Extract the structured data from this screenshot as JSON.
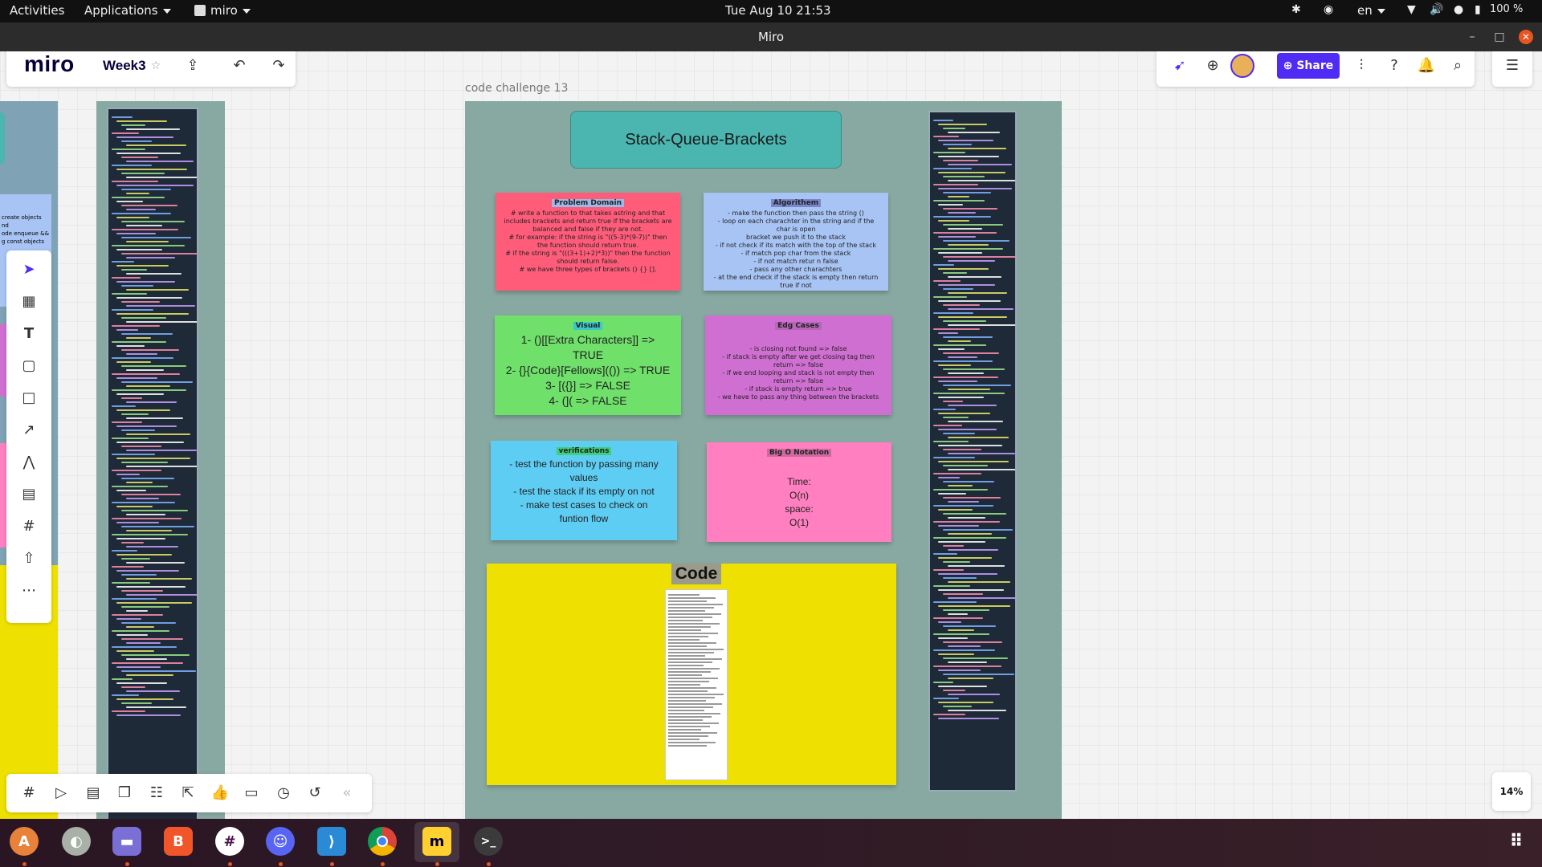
{
  "topbar": {
    "activities": "Activities",
    "applications": "Applications",
    "app": "miro",
    "datetime": "Tue Aug 10  21:53",
    "lang": "en",
    "battery": "100 %"
  },
  "window": {
    "title": "Miro"
  },
  "toolbar": {
    "logo": "miro",
    "board_name": "Week3",
    "share_label": "Share"
  },
  "frame": {
    "label": "code challenge 13"
  },
  "board": {
    "title": "Stack-Queue-Brackets",
    "problem_domain": {
      "header": "Problem Domain",
      "text": "# write a function to that takes astring and that\nincludes brackets and return true if the brackets are\nbalanced and false if they are not.\n# for example: if the string is \"((5-3)*(9-7))\" then\nthe function should return true.\n# if the string is \"(((3+1)+2)*3))\" then the function\nshould return false.\n# we have three types of brackets () {} []."
    },
    "algorithm": {
      "header": "Algorithem",
      "text": "- make the function then pass the string ()\n- loop on each charachter in the string and if the char is open\nbracket we push it to the stack\n- if not check if its match with the top of the stack\n- if match pop char from the stack\n- if not match retur n false\n- pass any other charachters\n- at the end check if the stack is empty then return true if not\nreturn false"
    },
    "visual": {
      "header": "Visual",
      "text": "1- ()[[Extra Characters]] =>\nTRUE\n2- {}{Code}[Fellows](()) => TRUE\n3- [({}] => FALSE\n4- (](  => FALSE"
    },
    "edge_cases": {
      "header": "Edg Cases",
      "text": "- is closing not found => false\n- if stack is empty after we get closing tag then return => false\n- if we end looping and stack is not empty then return => false\n- if stack is empty return => true\n- we have to pass any thing between the brackets"
    },
    "verifications": {
      "header": "verifications",
      "text": "- test the function by passing many\nvalues\n- test the stack if its empty on not\n- make test cases to check on\nfuntion flow"
    },
    "big_o": {
      "header": "Big O Notation",
      "text": "Time:\nO(n)\nspace:\nO(1)"
    },
    "code": {
      "header": "Code"
    }
  },
  "left_partial_text": "create objects\nnd\node enqueue &&\ng const objects",
  "zoom": "14%",
  "icons": {
    "left_toolbar": [
      "cursor-icon",
      "templates-icon",
      "text-icon",
      "sticky-note-icon",
      "shape-icon",
      "arrow-icon",
      "pen-icon",
      "comment-icon",
      "frame-icon",
      "upload-icon",
      "more-icon"
    ],
    "bottom_toolbar": [
      "frames-icon",
      "presentation-icon",
      "comments-icon",
      "cards-icon",
      "kanban-icon",
      "export-icon",
      "like-icon",
      "video-icon",
      "timer-icon",
      "history-icon",
      "collapse-icon"
    ],
    "dock": [
      "ubuntu-software-icon",
      "toggle-icon",
      "files-icon",
      "brave-icon",
      "slack-icon",
      "discord-icon",
      "vscode-icon",
      "chrome-icon",
      "miro-icon",
      "terminal-icon",
      "app-grid-icon"
    ]
  },
  "colors": {
    "problem_domain": "#ff5c7a",
    "algorithm": "#a8c4f4",
    "visual": "#6fe06a",
    "edge_cases": "#cf6fd1",
    "verifications": "#5ecdf4",
    "big_o": "#ff7fc0",
    "code": "#eee000",
    "frame": "#87a9a1",
    "share": "#4f2bf4"
  }
}
